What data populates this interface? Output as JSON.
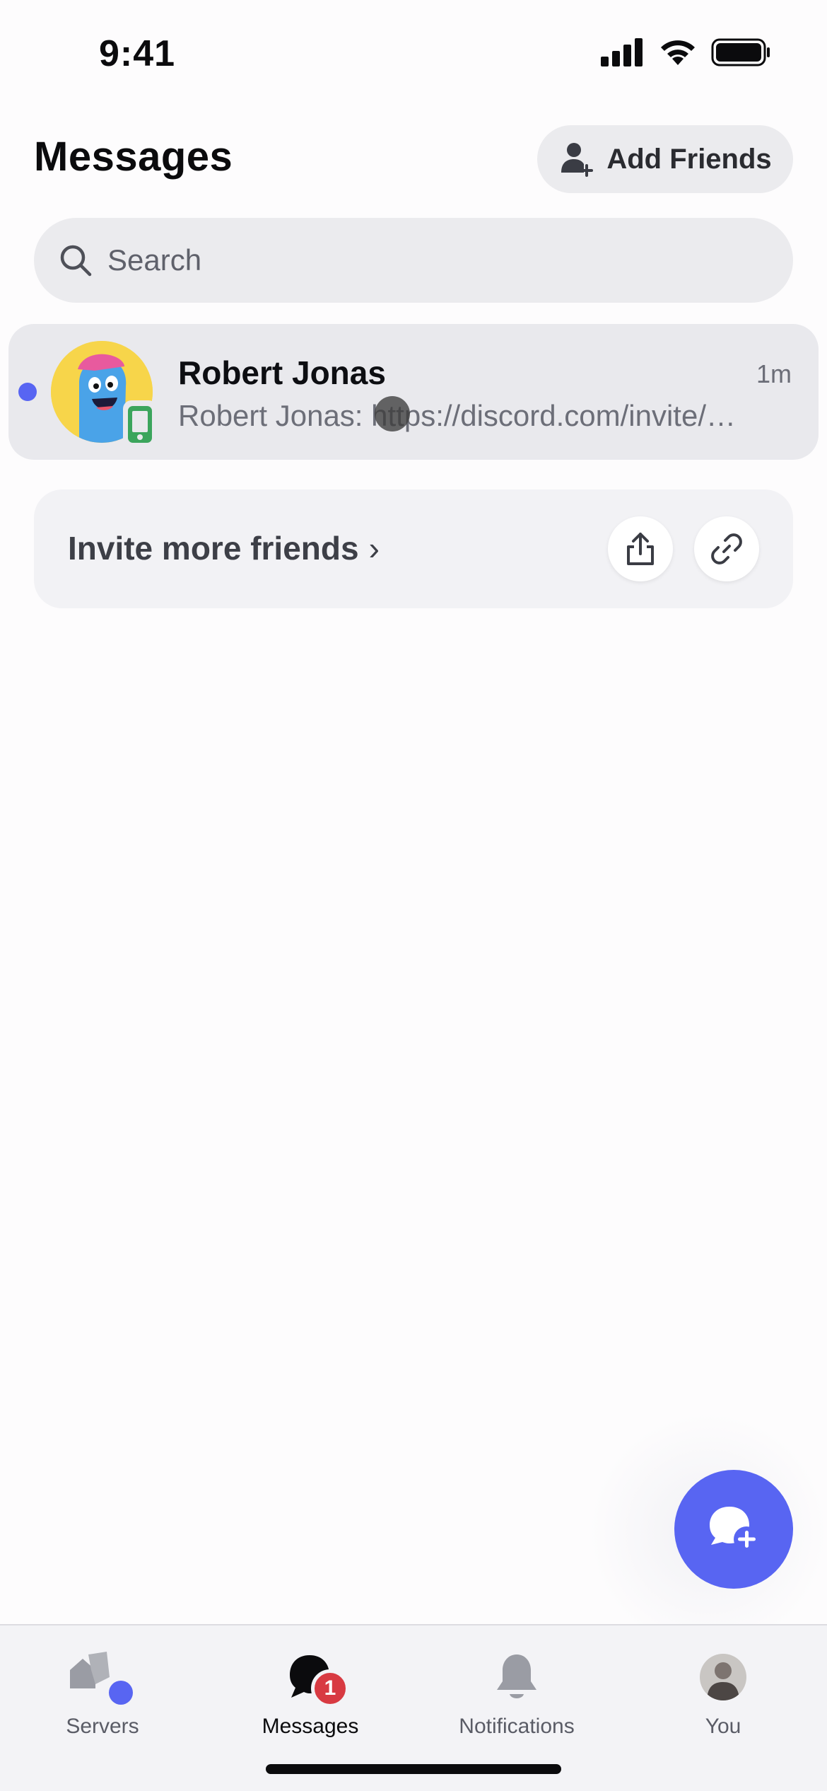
{
  "status_bar": {
    "time": "9:41"
  },
  "header": {
    "title": "Messages",
    "add_friends_label": "Add Friends"
  },
  "search": {
    "placeholder": "Search",
    "value": ""
  },
  "conversations": [
    {
      "name": "Robert Jonas",
      "time": "1m",
      "preview": "Robert Jonas: https://discord.com/invite/…",
      "unread": true,
      "device": "mobile"
    }
  ],
  "invite": {
    "label": "Invite more friends",
    "chevron": "›"
  },
  "fab": {
    "icon": "new-message-icon"
  },
  "tabs": [
    {
      "label": "Servers",
      "icon": "servers-icon"
    },
    {
      "label": "Messages",
      "icon": "messages-icon",
      "badge": "1",
      "active": true
    },
    {
      "label": "Notifications",
      "icon": "bell-icon"
    },
    {
      "label": "You",
      "icon": "avatar"
    }
  ],
  "colors": {
    "accent": "#5865f2",
    "badge": "#d83a42",
    "online": "#3ba55c"
  }
}
